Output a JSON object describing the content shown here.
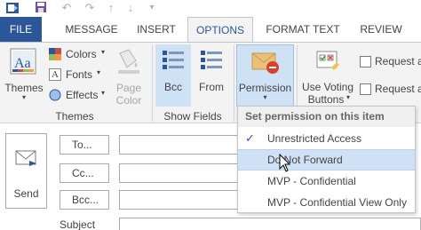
{
  "qat": {
    "save_icon": "save-icon",
    "undo_icon": "undo-icon",
    "redo_icon": "redo-icon",
    "up_icon": "up-arrow-icon",
    "down_icon": "down-arrow-icon",
    "customize_icon": "customize-icon"
  },
  "tabs": {
    "file": "FILE",
    "message": "MESSAGE",
    "insert": "INSERT",
    "options": "OPTIONS",
    "format_text": "FORMAT TEXT",
    "review": "REVIEW"
  },
  "ribbon": {
    "themes": {
      "themes_button": "Themes",
      "colors": "Colors",
      "fonts": "Fonts",
      "effects": "Effects",
      "page_color_line1": "Page",
      "page_color_line2": "Color",
      "group_label": "Themes"
    },
    "show_fields": {
      "bcc": "Bcc",
      "from": "From",
      "group_label": "Show Fields"
    },
    "permission": {
      "label": "Permission"
    },
    "tracking": {
      "use_voting_line1": "Use Voting",
      "use_voting_line2": "Buttons",
      "request_a_1": "Request a",
      "request_a_2": "Request a"
    }
  },
  "compose": {
    "send": "Send",
    "to": "To...",
    "cc": "Cc...",
    "bcc": "Bcc...",
    "subject": "Subject"
  },
  "menu": {
    "header": "Set permission on this item",
    "items": [
      {
        "label": "Unrestricted Access",
        "checked": true
      },
      {
        "label": "Do Not Forward",
        "hover": true
      },
      {
        "label": "MVP - Confidential"
      },
      {
        "label": "MVP - Confidential View Only"
      }
    ]
  },
  "colors": {
    "accent": "#2b579a",
    "hover": "#cfe1f5",
    "ribbon_bg": "#f3f3f3"
  }
}
